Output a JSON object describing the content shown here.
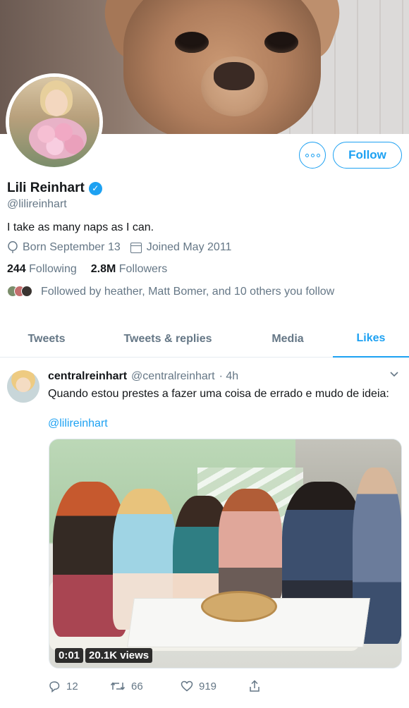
{
  "profile": {
    "name": "Lili Reinhart",
    "handle": "@lilireinhart",
    "bio": "I take as many naps as I can.",
    "birthday": "Born September 13",
    "joined": "Joined May 2011",
    "following_count": "244",
    "following_label": "Following",
    "followers_count": "2.8M",
    "followers_label": "Followers",
    "followed_by": "Followed by heather, Matt Bomer, and 10 others you follow",
    "follow_button": "Follow",
    "verified_icon": "✓"
  },
  "tabs": [
    "Tweets",
    "Tweets & replies",
    "Media",
    "Likes"
  ],
  "active_tab": "Likes",
  "tweet": {
    "name": "centralreinhart",
    "handle": "@centralreinhart",
    "time": "· 4h",
    "text": "Quando estou prestes a fazer uma coisa de errado e mudo de ideia:",
    "mention": "@lilireinhart",
    "video_time": "0:01",
    "video_views": "20.1K views",
    "replies": "12",
    "retweets": "66",
    "likes": "919"
  },
  "colors": {
    "accent": "#1da1f2",
    "secondary_text": "#657786"
  }
}
